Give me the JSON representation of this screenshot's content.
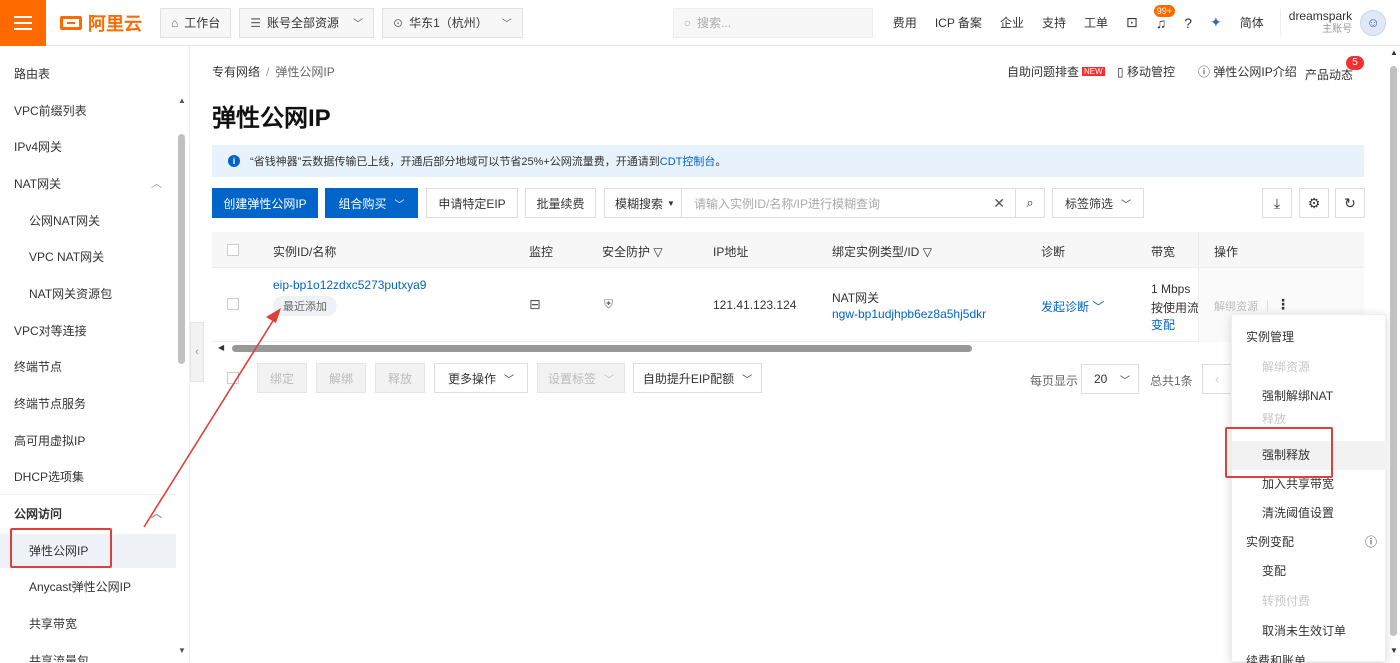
{
  "header": {
    "logo": "阿里云",
    "workbench": "工作台",
    "account_scope": "账号全部资源",
    "region": "华东1（杭州）",
    "search_placeholder": "搜索...",
    "nav": [
      "费用",
      "ICP 备案",
      "企业",
      "支持",
      "工单"
    ],
    "notif_count": "99+",
    "lang": "简体",
    "user_name": "dreamspark",
    "user_role": "主账号"
  },
  "sidebar": {
    "items": [
      {
        "label": "路由表",
        "level": 1
      },
      {
        "label": "VPC前缀列表",
        "level": 1
      },
      {
        "label": "IPv4网关",
        "level": 1
      },
      {
        "label": "NAT网关",
        "level": 1
      },
      {
        "label": "公网NAT网关",
        "level": 2
      },
      {
        "label": "VPC NAT网关",
        "level": 2
      },
      {
        "label": "NAT网关资源包",
        "level": 2
      },
      {
        "label": "VPC对等连接",
        "level": 1
      },
      {
        "label": "终端节点",
        "level": 1
      },
      {
        "label": "终端节点服务",
        "level": 1
      },
      {
        "label": "高可用虚拟IP",
        "level": 1
      },
      {
        "label": "DHCP选项集",
        "level": 1
      },
      {
        "label": "公网访问",
        "level": 1
      },
      {
        "label": "弹性公网IP",
        "level": 2
      },
      {
        "label": "Anycast弹性公网IP",
        "level": 2
      },
      {
        "label": "共享带宽",
        "level": 2
      },
      {
        "label": "共享流量包",
        "level": 2
      }
    ]
  },
  "breadcrumb": {
    "root": "专有网络",
    "current": "弹性公网IP"
  },
  "page_title": "弹性公网IP",
  "header_links": {
    "troubleshoot": "自助问题排查",
    "new_tag": "NEW",
    "mobile": "移动管控",
    "intro": "弹性公网IP介绍",
    "news": "产品动态",
    "news_count": "5"
  },
  "notice": {
    "text": "“省钱神器”云数据传输已上线，开通后部分地域可以节省25%+公网流量费，开通请到",
    "link": "CDT控制台",
    "end": "。"
  },
  "toolbar": {
    "create": "创建弹性公网IP",
    "bundle": "组合购买",
    "apply": "申请特定EIP",
    "renew": "批量续费",
    "search_mode": "模糊搜索",
    "search_placeholder": "请输入实例ID/名称/IP进行模糊查询",
    "tag_filter": "标签筛选"
  },
  "table": {
    "columns": [
      "实例ID/名称",
      "监控",
      "安全防护",
      "IP地址",
      "绑定实例类型/ID",
      "诊断",
      "带宽",
      "操作"
    ],
    "row": {
      "id": "eip-bp1o12zdxc5273putxya9",
      "tag": "最近添加",
      "ip": "121.41.123.124",
      "bind_type": "NAT网关",
      "bind_id": "ngw-bp1udjhpb6ez8a5hj5dkr",
      "diagnose": "发起诊断",
      "bandwidth": "1 Mbps",
      "billing": "按使用流量",
      "change": "变配",
      "unbind": "解绑资源"
    }
  },
  "bottom": {
    "bind": "绑定",
    "unbind": "解绑",
    "release": "释放",
    "more": "更多操作",
    "set_tag": "设置标签",
    "quota": "自助提升EIP配额",
    "per_page_label": "每页显示",
    "per_page": "20",
    "total": "总共1条"
  },
  "menu": {
    "items": [
      {
        "label": "实例管理",
        "type": "group"
      },
      {
        "label": "解绑资源",
        "type": "disabled"
      },
      {
        "label": "强制解绑NAT",
        "type": "sub"
      },
      {
        "label": "释放",
        "type": "disabled"
      },
      {
        "label": "强制释放",
        "type": "highlight"
      },
      {
        "label": "加入共享带宽",
        "type": "sub"
      },
      {
        "label": "清洗阈值设置",
        "type": "sub"
      },
      {
        "label": "实例变配",
        "type": "group"
      },
      {
        "label": "变配",
        "type": "sub"
      },
      {
        "label": "转预付费",
        "type": "disabled"
      },
      {
        "label": "取消未生效订单",
        "type": "sub"
      },
      {
        "label": "续费和账单",
        "type": "group"
      }
    ]
  },
  "colors": {
    "accent": "#0064c8",
    "brand": "#ff6a00",
    "highlight": "#e0403a"
  }
}
